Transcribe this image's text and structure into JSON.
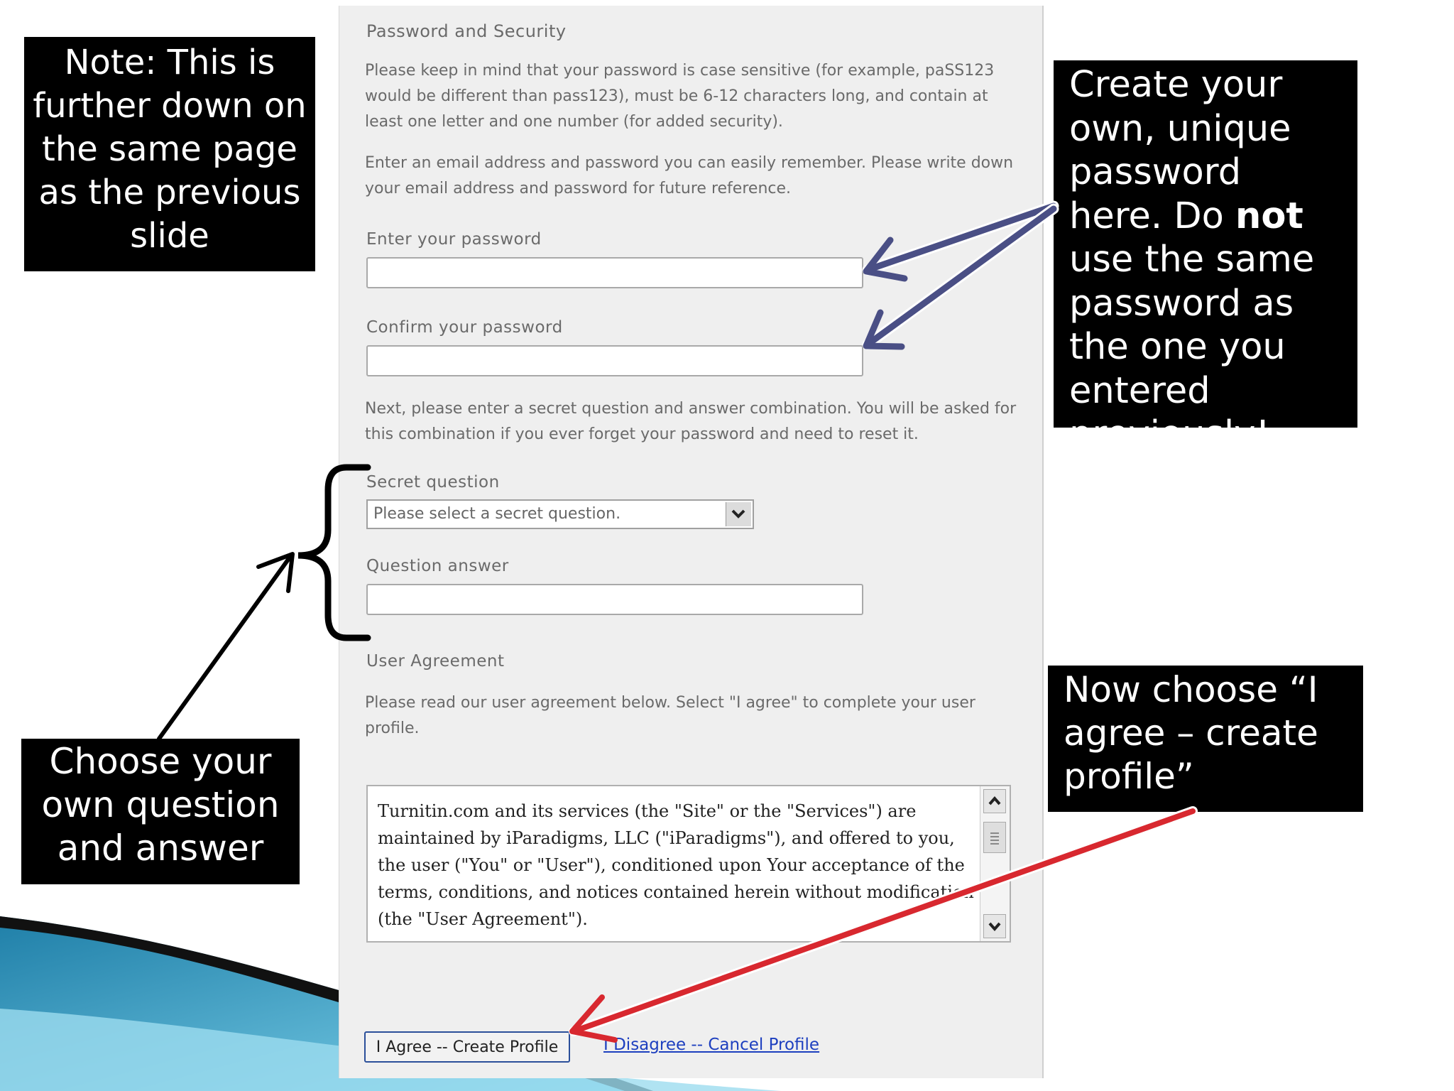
{
  "form": {
    "section_title": "Password and Security",
    "password_note": "Please keep in mind that your password is case sensitive (for example, paSS123 would be different than pass123), must be 6-12 characters long, and contain at least one letter and one number (for added security).",
    "email_note": "Enter an email address and password you can easily remember. Please write down your email address and password for future reference.",
    "password_label": "Enter your password",
    "password_value": "",
    "confirm_label": "Confirm your password",
    "confirm_value": "",
    "secret_note": "Next, please enter a secret question and answer combination. You will be asked for this combination if you ever forget your password and need to reset it.",
    "secret_question_label": "Secret question",
    "secret_question_selected": "Please select a secret question.",
    "question_answer_label": "Question answer",
    "question_answer_value": "",
    "user_agreement_title": "User Agreement",
    "user_agreement_note": "Please read our user agreement below. Select \"I agree\" to complete your user profile.",
    "agreement_text": "Turnitin.com and its services (the \"Site\" or the \"Services\") are maintained by iParadigms, LLC (\"iParadigms\"), and offered to you, the user (\"You\" or \"User\"), conditioned upon Your acceptance of the terms, conditions, and notices contained herein without modification (the \"User Agreement\").",
    "agree_button": "I Agree -- Create Profile",
    "disagree_link": "I Disagree -- Cancel Profile"
  },
  "callouts": {
    "note": "Note: This is further down on the same page as the previous slide",
    "password_pre": "Create your own, unique password here. Do ",
    "password_bold": "not",
    "password_post": " use the same password as the one you entered previously!",
    "question": "Choose your own question and answer",
    "agree": "Now choose “I agree – create profile”"
  },
  "icons": {
    "dropdown": "chevron-down-icon",
    "scroll_up": "arrow-up-icon",
    "scroll_down": "arrow-down-icon"
  },
  "colors": {
    "callout_bg": "#000000",
    "password_arrow": "#4a4f85",
    "agree_arrow": "#d8282f",
    "link": "#1d3fbf"
  }
}
